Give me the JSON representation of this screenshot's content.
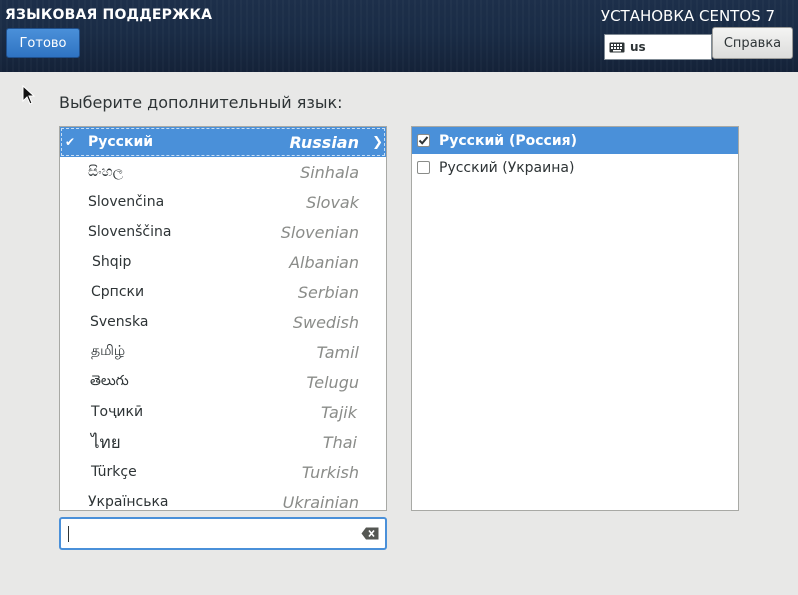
{
  "header": {
    "spoke_title": "ЯЗЫКОВАЯ ПОДДЕРЖКА",
    "done_label": "Готово",
    "product_title": "УСТАНОВКА CENTOS 7",
    "keyboard_layout": "us",
    "help_label": "Справка",
    "keyboard_icon": "keyboard-icon"
  },
  "main": {
    "prompt": "Выберите дополнительный язык:",
    "languages": [
      {
        "native": "Русский",
        "english": "Russian"
      },
      {
        "native": "සිංහල",
        "english": "Sinhala"
      },
      {
        "native": "Slovenčina",
        "english": "Slovak"
      },
      {
        "native": "Slovenščina",
        "english": "Slovenian"
      },
      {
        "native": "Shqip",
        "english": "Albanian"
      },
      {
        "native": "Српски",
        "english": "Serbian"
      },
      {
        "native": "Svenska",
        "english": "Swedish"
      },
      {
        "native": "தமிழ்",
        "english": "Tamil"
      },
      {
        "native": "తెలుగు",
        "english": "Telugu"
      },
      {
        "native": "Тоҷикӣ",
        "english": "Tajik"
      },
      {
        "native": "ไทย",
        "english": "Thai"
      },
      {
        "native": "Türkçe",
        "english": "Turkish"
      },
      {
        "native": "Українська",
        "english": "Ukrainian"
      }
    ],
    "locales": [
      {
        "label": "Русский (Россия)",
        "checked": true
      },
      {
        "label": "Русский (Украина)",
        "checked": false
      }
    ],
    "search": {
      "value": "",
      "clear_icon": "clear-text-icon"
    }
  },
  "colors": {
    "accent": "#4a90d9",
    "header_bg": "#1d2f4a",
    "background": "#e8e8e7"
  }
}
